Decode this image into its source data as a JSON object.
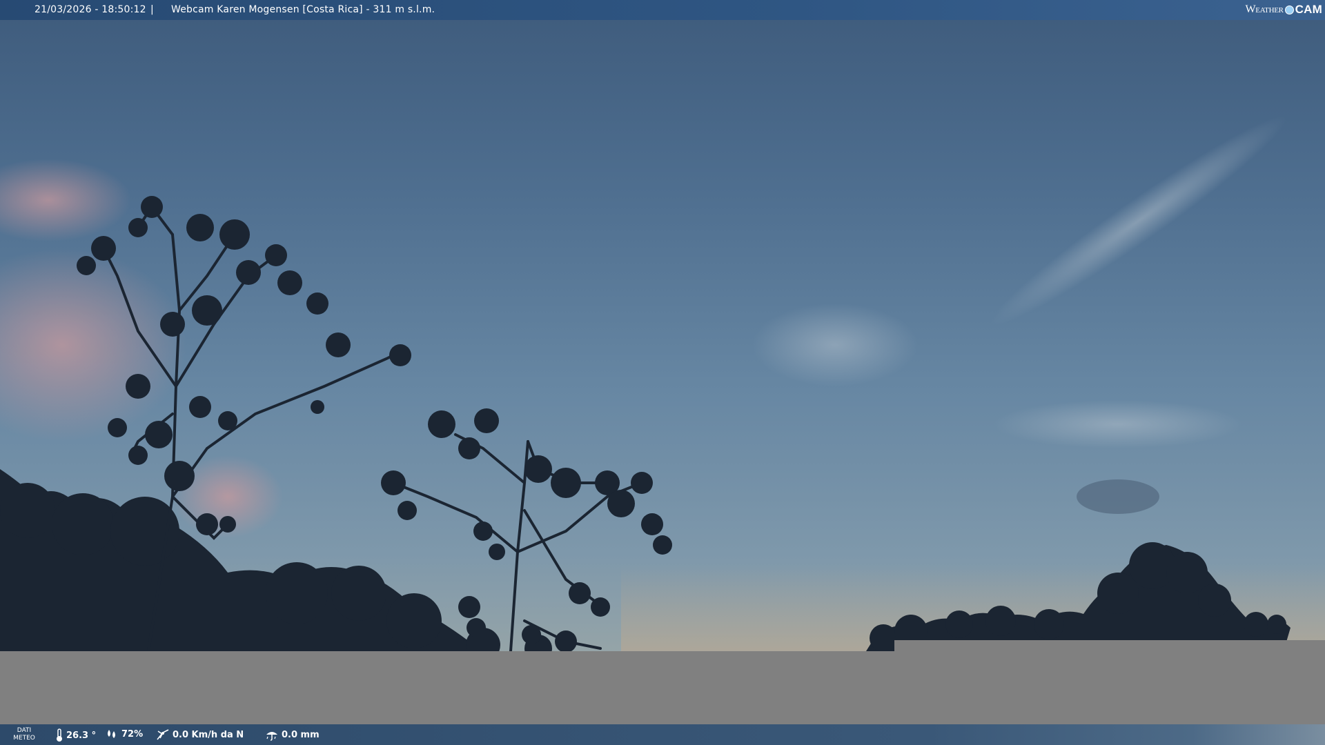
{
  "header": {
    "datetime": "21/03/2026 - 18:50:12",
    "separator": "|",
    "title": "Webcam Karen Mogensen [Costa Rica]  - 311 m s.l.m.",
    "brand_word": "Weather",
    "brand_cam": "CAM"
  },
  "footer": {
    "label_line1": "DATI",
    "label_line2": "METEO",
    "temperature": "26.3 °",
    "humidity": "72%",
    "wind": "0.0 Km/h da N",
    "rain": "0.0 mm"
  },
  "icons": [
    "thermometer-icon",
    "humidity-icon",
    "wind-icon",
    "rain-icon"
  ],
  "colors": {
    "header_bar": "#2f5683",
    "footer_bar": "#3a5878",
    "gray_fill": "#808080"
  }
}
